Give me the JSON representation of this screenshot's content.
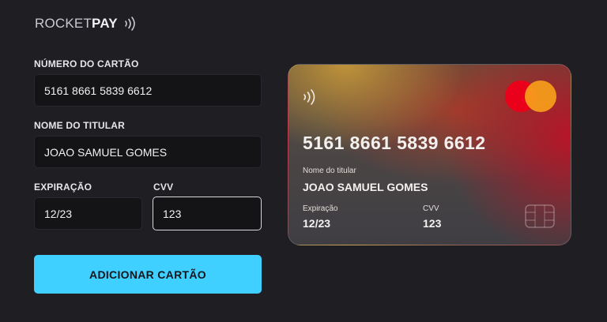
{
  "brand": {
    "light": "ROCKET",
    "bold": "PAY"
  },
  "form": {
    "card_number_label": "NÚMERO DO CARTÃO",
    "card_number_value": "5161 8661 5839 6612",
    "holder_label": "NOME DO TITULAR",
    "holder_value": "JOAO SAMUEL GOMES",
    "expiry_label": "EXPIRAÇÃO",
    "expiry_value": "12/23",
    "cvv_label": "CVV",
    "cvv_value": "123",
    "submit_label": "ADICIONAR CARTÃO"
  },
  "card": {
    "number": "5161 8661 5839 6612",
    "holder_label": "Nome do titular",
    "holder_value": "JOAO SAMUEL GOMES",
    "expiry_label": "Expiração",
    "expiry_value": "12/23",
    "cvv_label": "CVV",
    "cvv_value": "123",
    "network_icon": "mastercard-logo-icon"
  },
  "colors": {
    "background": "#1f1e23",
    "accent": "#40d0ff",
    "input_bg": "#141417"
  }
}
